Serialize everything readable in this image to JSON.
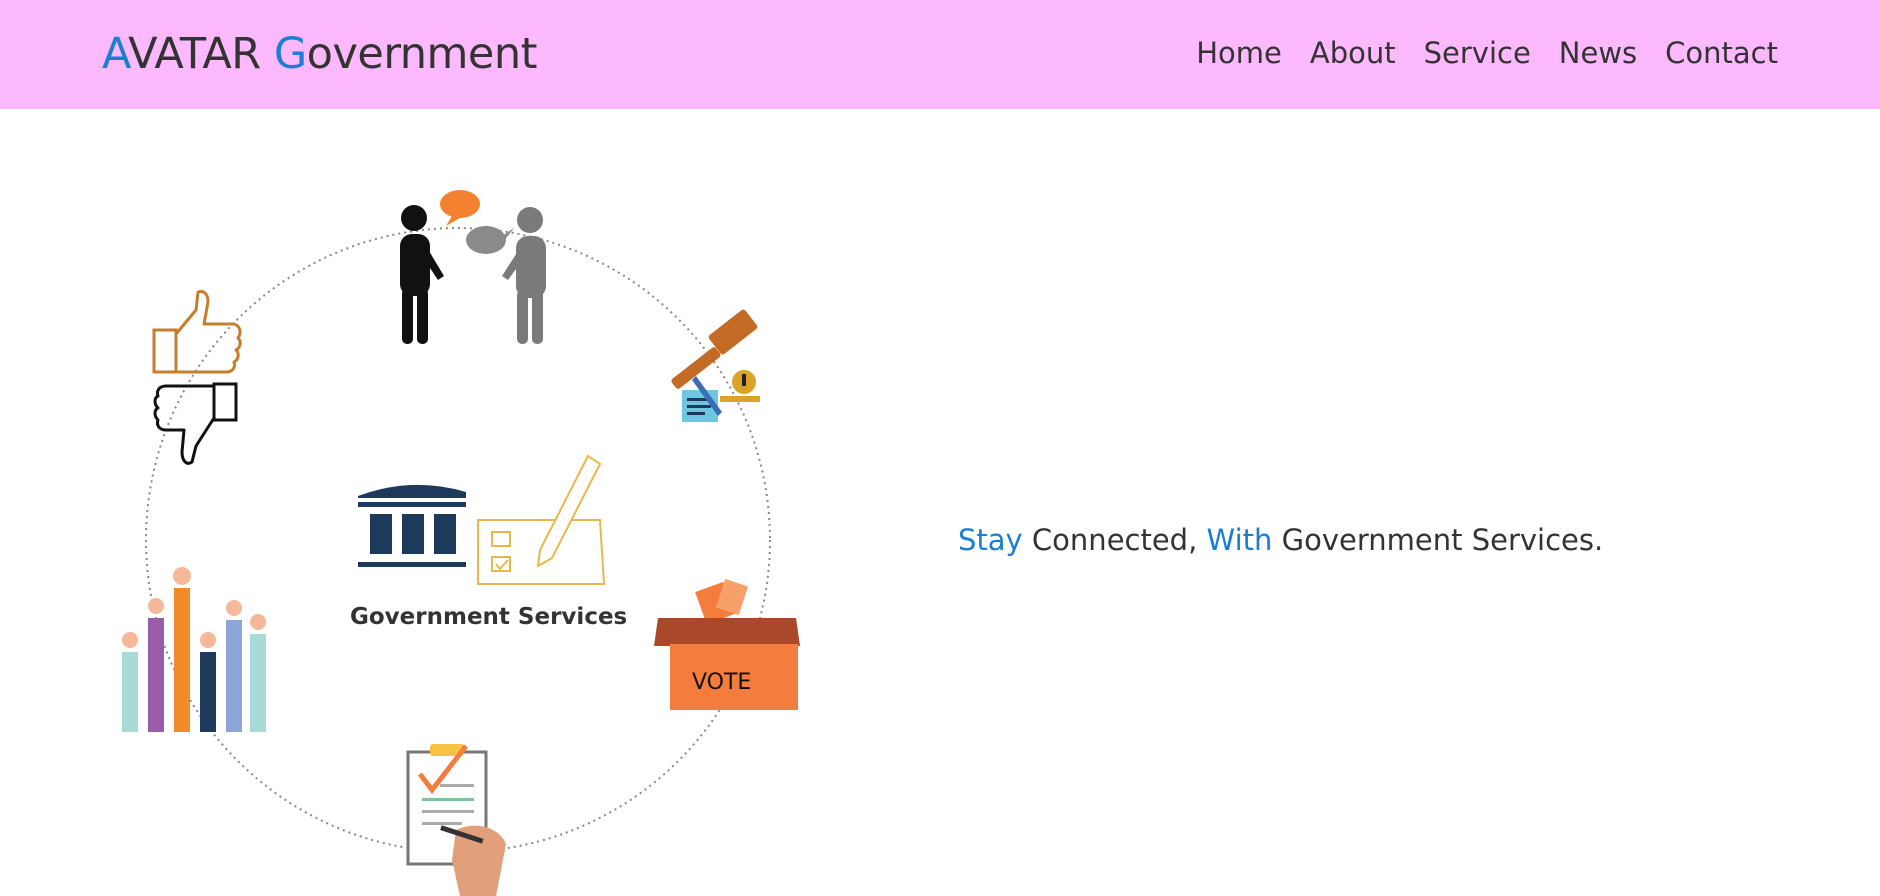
{
  "header": {
    "brand": {
      "part1_accent": "A",
      "part1_rest": "VATAR ",
      "part2_accent": "G",
      "part2_rest": "overnment"
    },
    "nav": [
      "Home",
      "About",
      "Service",
      "News",
      "Contact"
    ]
  },
  "hero": {
    "illustration": {
      "center_label": "Government Services",
      "vote_label": "VOTE",
      "icons": [
        "people-talking-icon",
        "gavel-icon",
        "vote-box-icon",
        "checklist-signing-icon",
        "raised-hands-icon",
        "thumbs-up-icon",
        "thumbs-down-icon",
        "government-building-icon",
        "ballot-pencil-icon"
      ]
    },
    "tagline": {
      "w1": "Stay",
      "w2": " Connected, ",
      "w3": "With",
      "w4": " Government Services."
    }
  },
  "colors": {
    "navbar_bg": "#fdb9fd",
    "accent": "#1a7fd4",
    "text": "#333333",
    "building": "#1d3a5c",
    "vote_box": "#f47c3c"
  }
}
